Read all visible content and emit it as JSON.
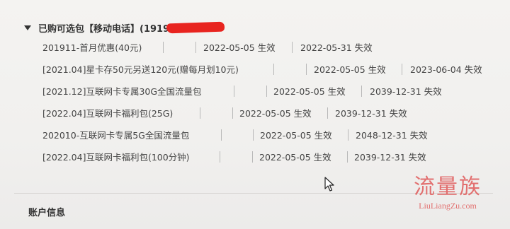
{
  "section": {
    "title": "已购可选包【移动电话】(1919",
    "redacted_suffix": "XXXXXXX)"
  },
  "packages": [
    {
      "name": "201911-首月优惠(40元)",
      "start": "2022-05-05 生效",
      "end": "2022-05-31 失效"
    },
    {
      "name": "[2021.04]星卡存50元另送120元(赠每月划10元)",
      "start": "2022-05-05 生效",
      "end": "2023-06-04 失效"
    },
    {
      "name": "[2021.12]互联网卡专属30G全国流量包",
      "start": "2022-05-05 生效",
      "end": "2039-12-31 失效"
    },
    {
      "name": "[2022.04]互联网卡福利包(25G)",
      "start": "2022-05-05 生效",
      "end": "2039-12-31 失效"
    },
    {
      "name": "202010-互联网卡专属5G全国流量包",
      "start": "2022-05-05 生效",
      "end": "2048-12-31 失效"
    },
    {
      "name": "[2022.04]互联网卡福利包(100分钟)",
      "start": "2022-05-05 生效",
      "end": "2039-12-31 失效"
    }
  ],
  "account_section": {
    "title": "账户信息"
  },
  "watermark": {
    "cn": "流量族",
    "en": "LiuLiangZu.com"
  },
  "icons": {
    "collapse": "caret-down-icon",
    "pointer": "mouse-cursor-icon"
  },
  "colors": {
    "redaction": "#e8241f",
    "watermark": "#e05a5a"
  }
}
